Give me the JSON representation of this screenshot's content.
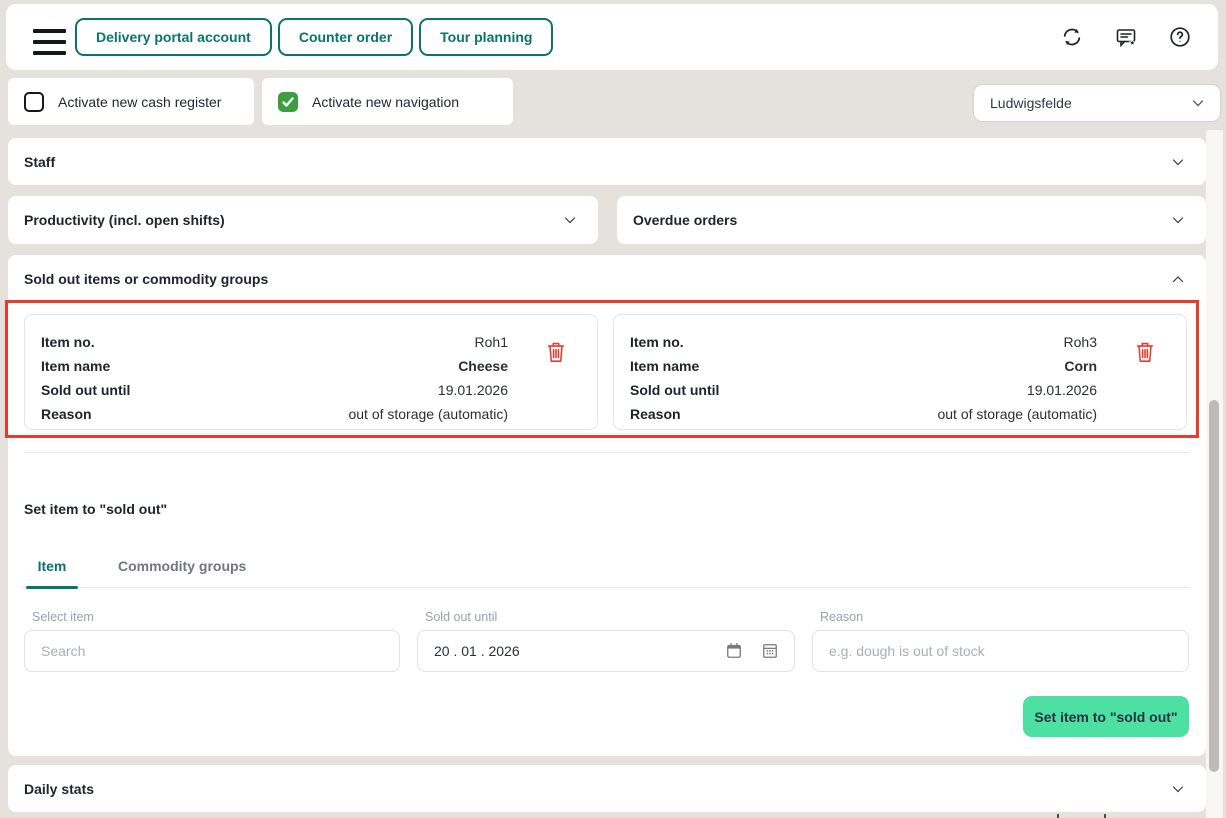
{
  "header": {
    "nav_buttons": [
      "Delivery portal account",
      "Counter order",
      "Tour planning"
    ],
    "action_icons": [
      "refresh",
      "feedback",
      "help"
    ]
  },
  "toggles": {
    "cash_register_label": "Activate new cash register",
    "cash_register_checked": false,
    "navigation_label": "Activate new navigation",
    "navigation_checked": true
  },
  "location_dropdown": {
    "value": "Ludwigsfelde"
  },
  "sections": {
    "staff": {
      "title": "Staff",
      "expanded": false
    },
    "productivity": {
      "title": "Productivity (incl. open shifts)",
      "expanded": false
    },
    "overdue_orders": {
      "title": "Overdue orders",
      "expanded": false
    },
    "daily_stats": {
      "title": "Daily stats",
      "expanded": false
    },
    "sold_out": {
      "title": "Sold out items or commodity groups",
      "expanded": true,
      "card_labels": {
        "item_no": "Item no.",
        "item_name": "Item name",
        "sold_out_until": "Sold out until",
        "reason": "Reason"
      },
      "items": [
        {
          "item_no": "Roh1",
          "item_name": "Cheese",
          "sold_out_until": "19.01.2026",
          "reason": "out of storage (automatic)"
        },
        {
          "item_no": "Roh3",
          "item_name": "Corn",
          "sold_out_until": "19.01.2026",
          "reason": "out of storage (automatic)"
        }
      ],
      "form": {
        "heading": "Set item to \"sold out\"",
        "tabs": [
          "Item",
          "Commodity groups"
        ],
        "active_tab": "Item",
        "select_item_label": "Select item",
        "select_item_placeholder": "Search",
        "date_label": "Sold out until",
        "date_value": "20 . 01 . 2026",
        "reason_label": "Reason",
        "reason_placeholder": "e.g. dough is out of stock",
        "submit_label": "Set item to \"sold out\""
      }
    }
  },
  "colors": {
    "teal": "#0b7468",
    "mint_green": "#4de0a3",
    "checkbox_green": "#3c9e42",
    "alert_red": "#e73b2d"
  }
}
